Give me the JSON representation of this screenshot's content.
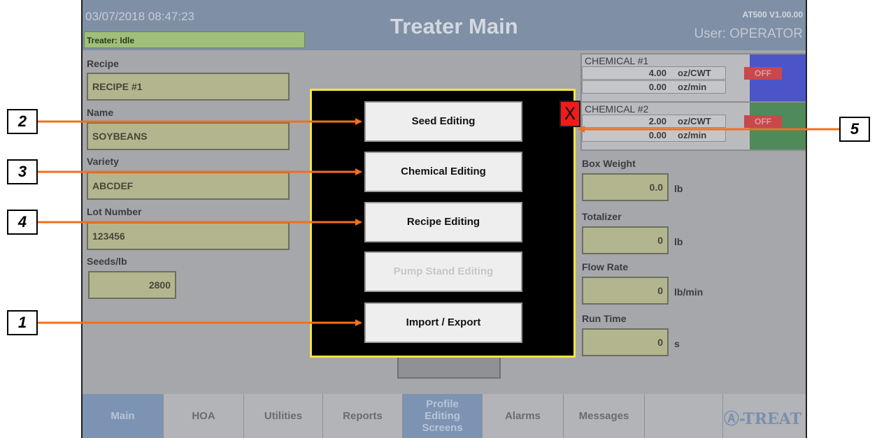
{
  "header": {
    "datetime": "03/07/2018 08:47:23",
    "status": "Treater: Idle",
    "title": "Treater Main",
    "version": "AT500 V1.00.00",
    "user": "User: OPERATOR"
  },
  "fields": {
    "recipe": {
      "label": "Recipe",
      "value": "RECIPE #1"
    },
    "name": {
      "label": "Name",
      "value": "SOYBEANS"
    },
    "variety": {
      "label": "Variety",
      "value": "ABCDEF"
    },
    "lot": {
      "label": "Lot Number",
      "value": "123456"
    },
    "seeds": {
      "label": "Seeds/lb",
      "value": "2800"
    }
  },
  "chemicals": [
    {
      "name": "CHEMICAL #1",
      "rate": "4.00",
      "rate_unit": "oz/CWT",
      "flow": "0.00",
      "flow_unit": "oz/min",
      "state": "OFF",
      "color": "#4c55c8"
    },
    {
      "name": "CHEMICAL #2",
      "rate": "2.00",
      "rate_unit": "oz/CWT",
      "flow": "0.00",
      "flow_unit": "oz/min",
      "state": "OFF",
      "color": "#4e8a5a"
    }
  ],
  "metrics": {
    "box_weight": {
      "label": "Box Weight",
      "value": "0.0",
      "unit": "lb"
    },
    "totalizer": {
      "label": "Totalizer",
      "value": "0",
      "unit": "lb"
    },
    "flow_rate": {
      "label": "Flow Rate",
      "value": "0",
      "unit": "lb/min"
    },
    "run_time": {
      "label": "Run Time",
      "value": "0",
      "unit": "s"
    }
  },
  "modal": {
    "close": "X",
    "buttons": [
      "Seed Editing",
      "Chemical Editing",
      "Recipe Editing",
      "Pump Stand Editing",
      "Import / Export"
    ]
  },
  "tabs": [
    "Main",
    "HOA",
    "Utilities",
    "Reports",
    "Profile Editing Screens",
    "Alarms",
    "Messages",
    ""
  ],
  "brand": "Ⓐ-TREAT",
  "callouts": [
    "2",
    "3",
    "4",
    "1",
    "5"
  ]
}
